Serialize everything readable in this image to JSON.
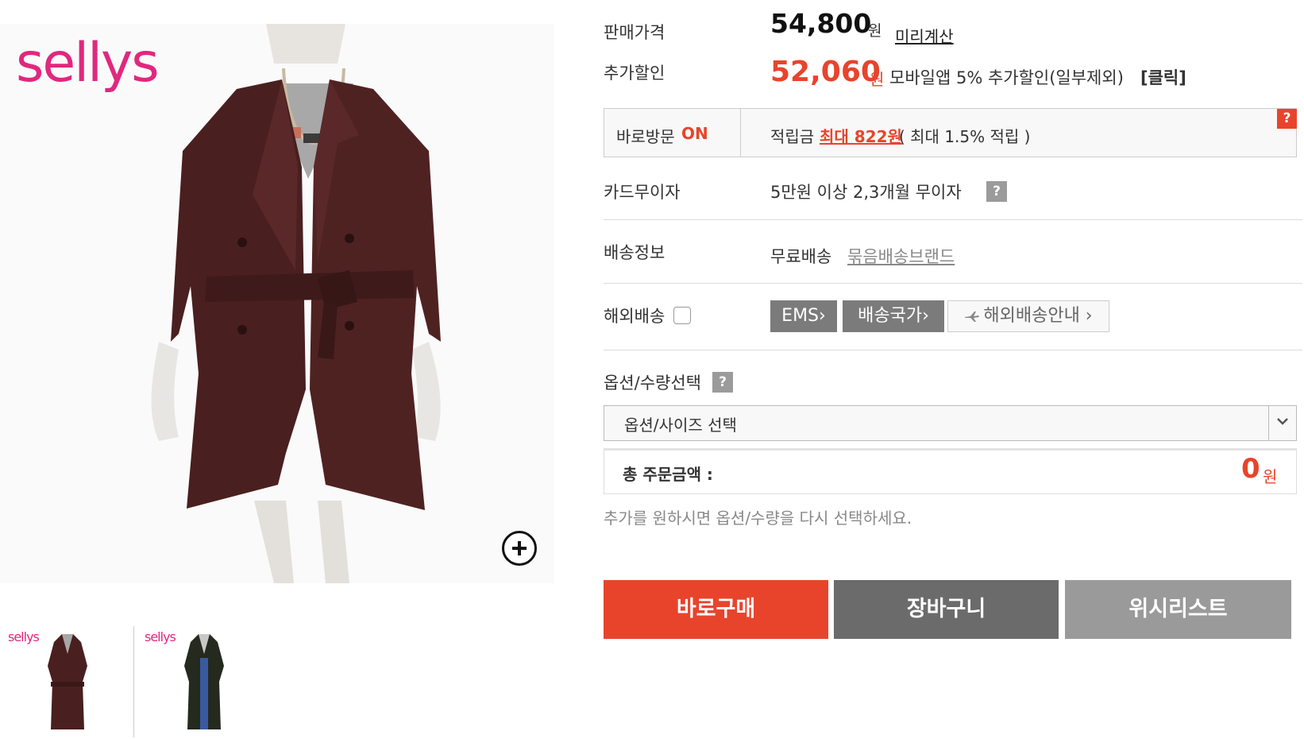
{
  "brand": {
    "logo_text": "sellys"
  },
  "price": {
    "label": "판매가격",
    "amount": "54,800",
    "unit": "원",
    "calc_link": "미리계산"
  },
  "discount": {
    "label": "추가할인",
    "amount": "52,060",
    "unit": "원",
    "description": "모바일앱 5% 추가할인(일부제외)",
    "click_label": "[클릭]"
  },
  "visit": {
    "label": "바로방문",
    "status": "ON",
    "points_label": "적립금",
    "points_max": "최대 822원",
    "points_rate": "( 최대 1.5% 적립 )",
    "help": "?"
  },
  "card": {
    "label": "카드무이자",
    "value": "5만원 이상 2,3개월 무이자",
    "help": "?"
  },
  "shipping": {
    "label": "배송정보",
    "value": "무료배송",
    "bundle_link": "묶음배송브랜드"
  },
  "overseas": {
    "label": "해외배송",
    "ems_button": "EMS›",
    "countries_button": "배송국가›",
    "guide_button": "해외배송안내 ›"
  },
  "option": {
    "label": "옵션/수량선택",
    "help": "?",
    "select_value": "옵션/사이즈 선택"
  },
  "total": {
    "label": "총 주문금액 :",
    "value": "0",
    "unit": "원"
  },
  "notice": "추가를 원하시면 옵션/수량을 다시 선택하세요.",
  "actions": {
    "buy_now": "바로구매",
    "cart": "장바구니",
    "wishlist": "위시리스트"
  },
  "colors": {
    "accent_red": "#e8442c",
    "brand_pink": "#e0287e",
    "cart_gray": "#6b6b6b",
    "wishlist_gray": "#9a9a9a"
  }
}
